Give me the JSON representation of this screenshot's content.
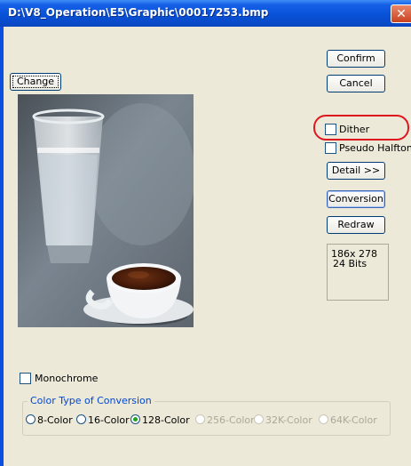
{
  "window": {
    "title": "D:\\V8_Operation\\E5\\Graphic\\00017253.bmp",
    "close_glyph": "✕"
  },
  "buttons": {
    "change": "Change",
    "confirm": "Confirm",
    "cancel": "Cancel",
    "detail": "Detail >>",
    "conversion": "Conversion",
    "redraw": "Redraw"
  },
  "options": {
    "dither": {
      "label": "Dither",
      "checked": false
    },
    "pseudo_halftone": {
      "label": "Pseudo Halftone",
      "checked": false
    },
    "monochrome": {
      "label": "Monochrome",
      "checked": false
    }
  },
  "image_info": {
    "size": "186x 278",
    "bits": "24 Bits"
  },
  "color_type": {
    "legend": "Color Type of Conversion",
    "selected": "128-Color",
    "choices": [
      {
        "label": "8-Color",
        "enabled": true
      },
      {
        "label": "16-Color",
        "enabled": true
      },
      {
        "label": "128-Color",
        "enabled": true
      },
      {
        "label": "256-Color",
        "enabled": false
      },
      {
        "label": "32K-Color",
        "enabled": false
      },
      {
        "label": "64K-Color",
        "enabled": false
      }
    ]
  },
  "colors": {
    "dialog_bg": "#ece9d8",
    "titlebar": "#0852d8",
    "annotation": "#e0161e",
    "group_legend": "#0046d5",
    "disabled_text": "#aca899"
  },
  "icons": [
    "close-icon",
    "checkbox-icon",
    "radio-icon"
  ]
}
